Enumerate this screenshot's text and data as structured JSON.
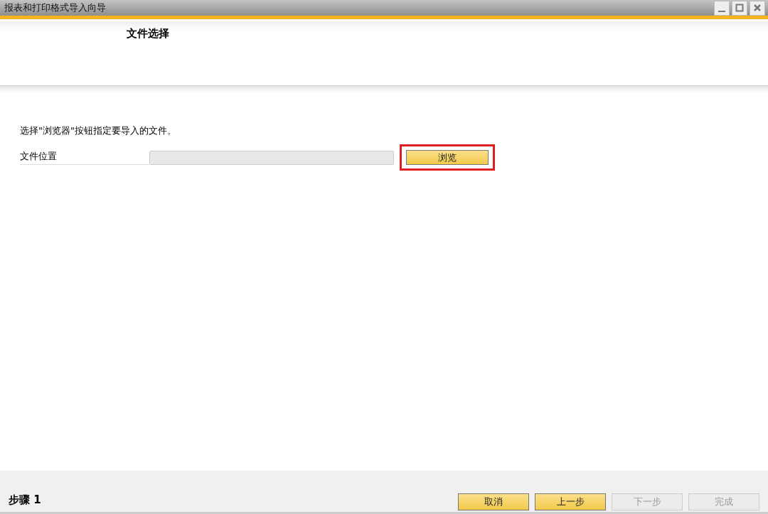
{
  "window": {
    "title": "报表和打印格式导入向导"
  },
  "header": {
    "title": "文件选择"
  },
  "instruction": "选择\"浏览器\"按钮指定要导入的文件。",
  "file_field": {
    "label": "文件位置",
    "disabled": true
  },
  "browse_button": {
    "label": "浏览",
    "highlighted": true
  },
  "step_label": "步骤 1",
  "buttons": [
    {
      "label": "取消",
      "disabled": false
    },
    {
      "label": "上一步",
      "disabled": false
    },
    {
      "label": "下一步",
      "disabled": true
    },
    {
      "label": "完成",
      "disabled": true
    }
  ]
}
